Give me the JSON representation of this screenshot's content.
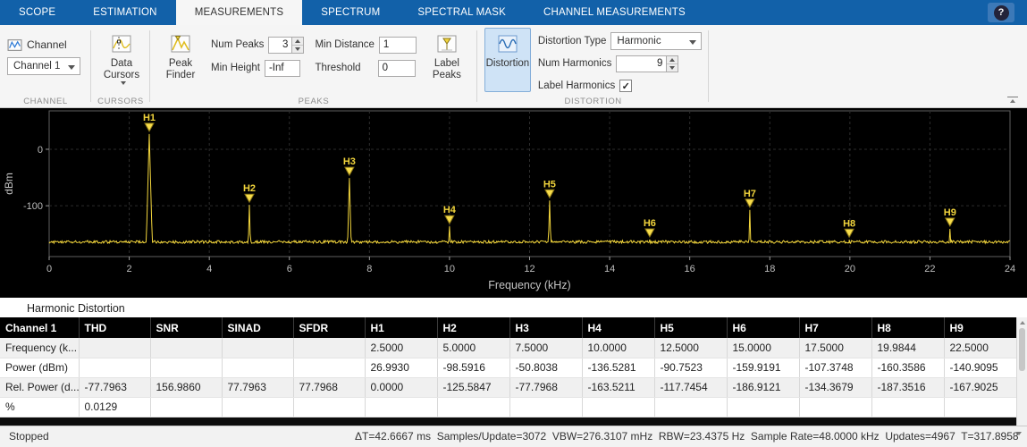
{
  "tabs": {
    "items": [
      {
        "label": "SCOPE",
        "active": false
      },
      {
        "label": "ESTIMATION",
        "active": false
      },
      {
        "label": "MEASUREMENTS",
        "active": true
      },
      {
        "label": "SPECTRUM",
        "active": false
      },
      {
        "label": "SPECTRAL MASK",
        "active": false
      },
      {
        "label": "CHANNEL MEASUREMENTS",
        "active": false
      }
    ]
  },
  "help": {
    "label": "?"
  },
  "ribbon": {
    "channel": {
      "section_label": "CHANNEL",
      "button_label": "Channel",
      "dropdown_value": "Channel 1"
    },
    "cursors": {
      "section_label": "CURSORS",
      "button_label": "Data Cursors"
    },
    "peaks": {
      "section_label": "PEAKS",
      "peak_finder_label": "Peak Finder",
      "num_peaks_label": "Num Peaks",
      "num_peaks_value": "3",
      "min_height_label": "Min Height",
      "min_height_value": "-Inf",
      "min_distance_label": "Min Distance",
      "min_distance_value": "1",
      "threshold_label": "Threshold",
      "threshold_value": "0",
      "label_peaks_label": "Label Peaks"
    },
    "distortion": {
      "section_label": "DISTORTION",
      "button_label": "Distortion",
      "type_label": "Distortion Type",
      "type_value": "Harmonic",
      "num_harmonics_label": "Num Harmonics",
      "num_harmonics_value": "9",
      "label_harmonics_label": "Label Harmonics",
      "label_harmonics_checked": true
    }
  },
  "chart_data": {
    "type": "line",
    "title": "",
    "xlabel": "Frequency (kHz)",
    "ylabel": "dBm",
    "xlim": [
      0,
      24
    ],
    "ylim": [
      -190,
      68
    ],
    "x_ticks": [
      0,
      2,
      4,
      6,
      8,
      10,
      12,
      14,
      16,
      18,
      20,
      22,
      24
    ],
    "y_ticks": [
      0,
      -100
    ],
    "grid": "dashed",
    "noise_floor_dbm": -165,
    "trace_color": "#f2d53c",
    "series": [
      {
        "name": "Channel 1",
        "markers": [
          {
            "label": "H1",
            "freq_khz": 2.5,
            "power_dbm": 26.993
          },
          {
            "label": "H2",
            "freq_khz": 5.0,
            "power_dbm": -98.5916
          },
          {
            "label": "H3",
            "freq_khz": 7.5,
            "power_dbm": -50.8038
          },
          {
            "label": "H4",
            "freq_khz": 10.0,
            "power_dbm": -136.5281
          },
          {
            "label": "H5",
            "freq_khz": 12.5,
            "power_dbm": -90.7523
          },
          {
            "label": "H6",
            "freq_khz": 15.0,
            "power_dbm": -159.9191
          },
          {
            "label": "H7",
            "freq_khz": 17.5,
            "power_dbm": -107.3748
          },
          {
            "label": "H8",
            "freq_khz": 19.9844,
            "power_dbm": -160.3586
          },
          {
            "label": "H9",
            "freq_khz": 22.5,
            "power_dbm": -140.9095
          }
        ]
      }
    ]
  },
  "panel": {
    "title": "Harmonic Distortion"
  },
  "table": {
    "columns": [
      "Channel 1",
      "THD",
      "SNR",
      "SINAD",
      "SFDR",
      "H1",
      "H2",
      "H3",
      "H4",
      "H5",
      "H6",
      "H7",
      "H8",
      "H9"
    ],
    "rows": [
      [
        "Frequency (k...",
        "",
        "",
        "",
        "",
        "2.5000",
        "5.0000",
        "7.5000",
        "10.0000",
        "12.5000",
        "15.0000",
        "17.5000",
        "19.9844",
        "22.5000"
      ],
      [
        "Power (dBm)",
        "",
        "",
        "",
        "",
        "26.9930",
        "-98.5916",
        "-50.8038",
        "-136.5281",
        "-90.7523",
        "-159.9191",
        "-107.3748",
        "-160.3586",
        "-140.9095"
      ],
      [
        "Rel. Power (d...",
        "-77.7963",
        "156.9860",
        "77.7963",
        "77.7968",
        "0.0000",
        "-125.5847",
        "-77.7968",
        "-163.5211",
        "-117.7454",
        "-186.9121",
        "-134.3679",
        "-187.3516",
        "-167.9025"
      ],
      [
        "%",
        "0.0129",
        "",
        "",
        "",
        "",
        "",
        "",
        "",
        "",
        "",
        "",
        "",
        ""
      ]
    ]
  },
  "status_bar": {
    "state": "Stopped",
    "stats": "ΔT=42.6667 ms  Samples/Update=3072  VBW=276.3107 mHz  RBW=23.4375 Hz  Sample Rate=48.0000 kHz  Updates=4967  T=317.8958"
  }
}
